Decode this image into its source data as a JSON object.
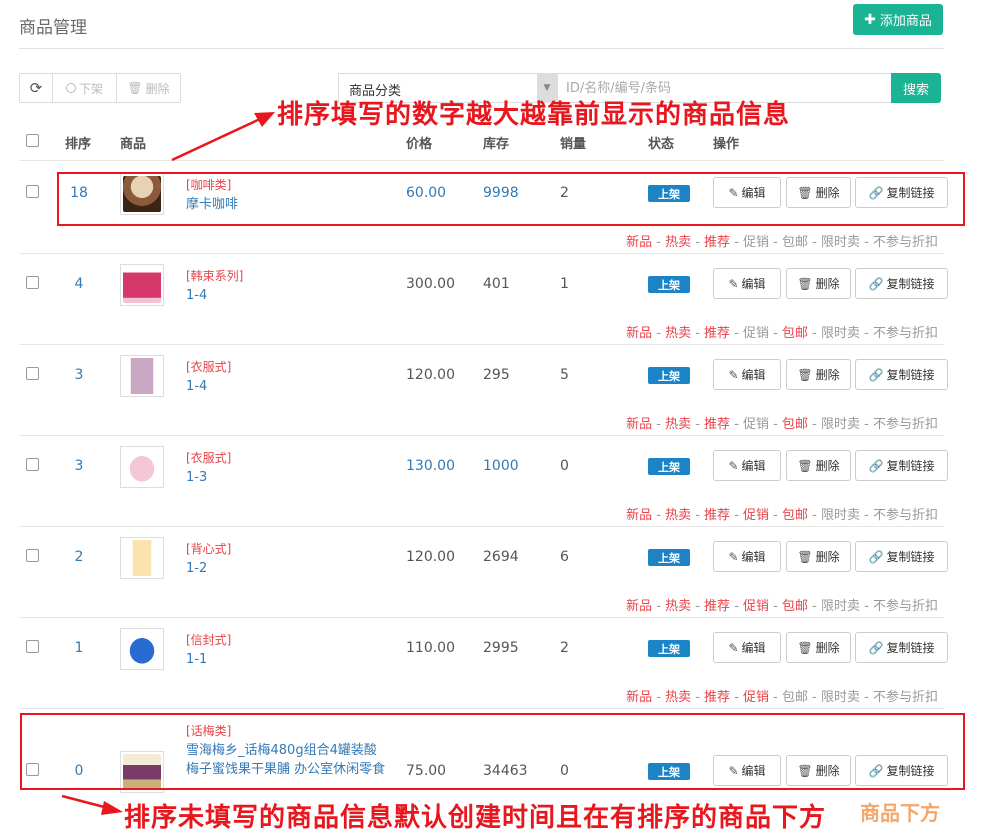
{
  "page": {
    "title": "商品管理",
    "add_label": "添加商品"
  },
  "toolbar": {
    "off_label": "下架",
    "delete_label": "删除"
  },
  "search": {
    "category_value": "商品分类",
    "placeholder": "ID/名称/编号/条码",
    "button_label": "搜索"
  },
  "table": {
    "headers": {
      "sort": "排序",
      "goods": "商品",
      "price": "价格",
      "stock": "库存",
      "sold": "销量",
      "status": "状态",
      "ops": "操作"
    },
    "ops": {
      "edit": "编辑",
      "delete": "删除",
      "copy": "复制链接"
    },
    "tag_names": [
      "新品",
      "热卖",
      "推荐",
      "促销",
      "包邮",
      "限时卖",
      "不参与折扣"
    ],
    "rows": [
      {
        "sort": "18",
        "category": "[咖啡类]",
        "name": "摩卡咖啡",
        "price": "60.00",
        "stock": "9998",
        "sold": "2",
        "status": "上架",
        "tags_on": [
          true,
          true,
          true,
          false,
          false,
          false,
          false
        ],
        "price_blue": true,
        "stock_blue": true,
        "thumb": "coffee"
      },
      {
        "sort": "4",
        "category": "[韩束系列]",
        "name": "1-4",
        "price": "300.00",
        "stock": "401",
        "sold": "1",
        "status": "上架",
        "tags_on": [
          true,
          true,
          true,
          false,
          true,
          false,
          false
        ],
        "price_blue": false,
        "stock_blue": false,
        "thumb": "cosmetic"
      },
      {
        "sort": "3",
        "category": "[衣服式]",
        "name": "1-4",
        "price": "120.00",
        "stock": "295",
        "sold": "5",
        "status": "上架",
        "tags_on": [
          true,
          true,
          true,
          false,
          true,
          false,
          false
        ],
        "price_blue": false,
        "stock_blue": false,
        "thumb": "pinkdress"
      },
      {
        "sort": "3",
        "category": "[衣服式]",
        "name": "1-3",
        "price": "130.00",
        "stock": "1000",
        "sold": "0",
        "status": "上架",
        "tags_on": [
          true,
          true,
          true,
          true,
          true,
          false,
          false
        ],
        "price_blue": true,
        "stock_blue": true,
        "thumb": "babysuit"
      },
      {
        "sort": "2",
        "category": "[背心式]",
        "name": "1-2",
        "price": "120.00",
        "stock": "2694",
        "sold": "6",
        "status": "上架",
        "tags_on": [
          true,
          true,
          true,
          true,
          true,
          false,
          false
        ],
        "price_blue": false,
        "stock_blue": false,
        "thumb": "sleepbag"
      },
      {
        "sort": "1",
        "category": "[信封式]",
        "name": "1-1",
        "price": "110.00",
        "stock": "2995",
        "sold": "2",
        "status": "上架",
        "tags_on": [
          true,
          true,
          true,
          true,
          false,
          false,
          false
        ],
        "price_blue": false,
        "stock_blue": false,
        "thumb": "bluebag"
      },
      {
        "sort": "0",
        "category": "[话梅类]",
        "name": "雪海梅乡_话梅480g组合4罐装酸梅子蜜饯果干果脯 办公室休闲零食",
        "price": "75.00",
        "stock": "34463",
        "sold": "0",
        "status": "上架",
        "tags_on": [],
        "price_blue": false,
        "stock_blue": false,
        "thumb": "plums"
      }
    ]
  },
  "annotations": {
    "top": "排序填写的数字越大越靠前显示的商品信息",
    "bottom": "排序未填写的商品信息默认创建时间且在有排序的商品下方"
  },
  "watermark": "商品下方",
  "colors": {
    "primary": "#1ab394",
    "link": "#337ab7",
    "status": "#1c84c6",
    "tag_on": "#e8434a",
    "annotation": "#e8161d"
  }
}
